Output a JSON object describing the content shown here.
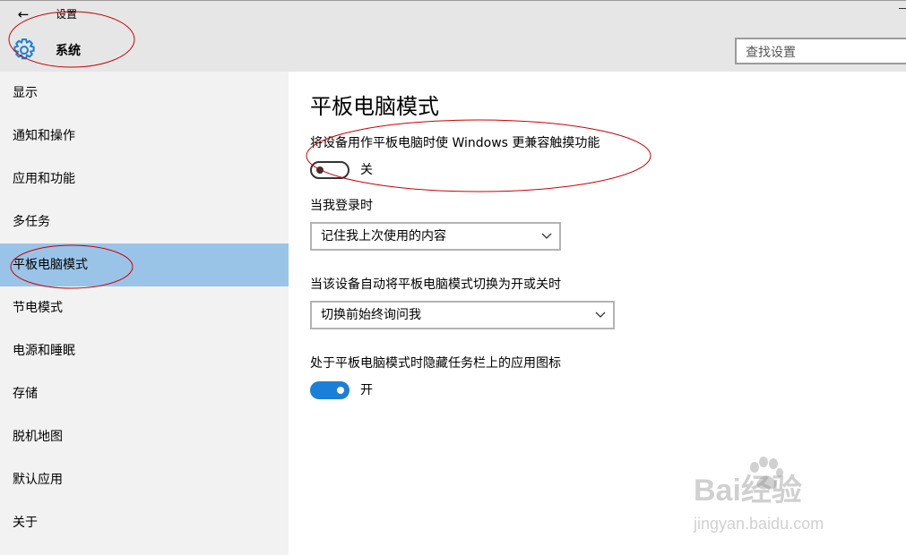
{
  "window": {
    "back_glyph": "←",
    "title": "设置",
    "section": "系统",
    "search_placeholder": "查找设置"
  },
  "sidebar": {
    "items": [
      {
        "label": "显示"
      },
      {
        "label": "通知和操作"
      },
      {
        "label": "应用和功能"
      },
      {
        "label": "多任务"
      },
      {
        "label": "平板电脑模式",
        "active": true
      },
      {
        "label": "节电模式"
      },
      {
        "label": "电源和睡眠"
      },
      {
        "label": "存储"
      },
      {
        "label": "脱机地图"
      },
      {
        "label": "默认应用"
      },
      {
        "label": "关于"
      }
    ]
  },
  "main": {
    "title": "平板电脑模式",
    "setting_tablet": {
      "label": "将设备用作平板电脑时使 Windows 更兼容触摸功能",
      "state": "关",
      "on": false
    },
    "setting_signin": {
      "label": "当我登录时",
      "value": "记住我上次使用的内容"
    },
    "setting_switch": {
      "label": "当该设备自动将平板电脑模式切换为开或关时",
      "value": "切换前始终询问我"
    },
    "setting_hide_icons": {
      "label": "处于平板电脑模式时隐藏任务栏上的应用图标",
      "state": "开",
      "on": true
    }
  },
  "watermark": {
    "brand": "Bai经验",
    "url": "jingyan.baidu.com"
  },
  "colors": {
    "titlebar_bg": "#e6e6e6",
    "sidebar_bg": "#f2f2f2",
    "active_item_bg": "#99c4e8",
    "accent": "#1a7fd6",
    "annotation": "#cc0000"
  }
}
